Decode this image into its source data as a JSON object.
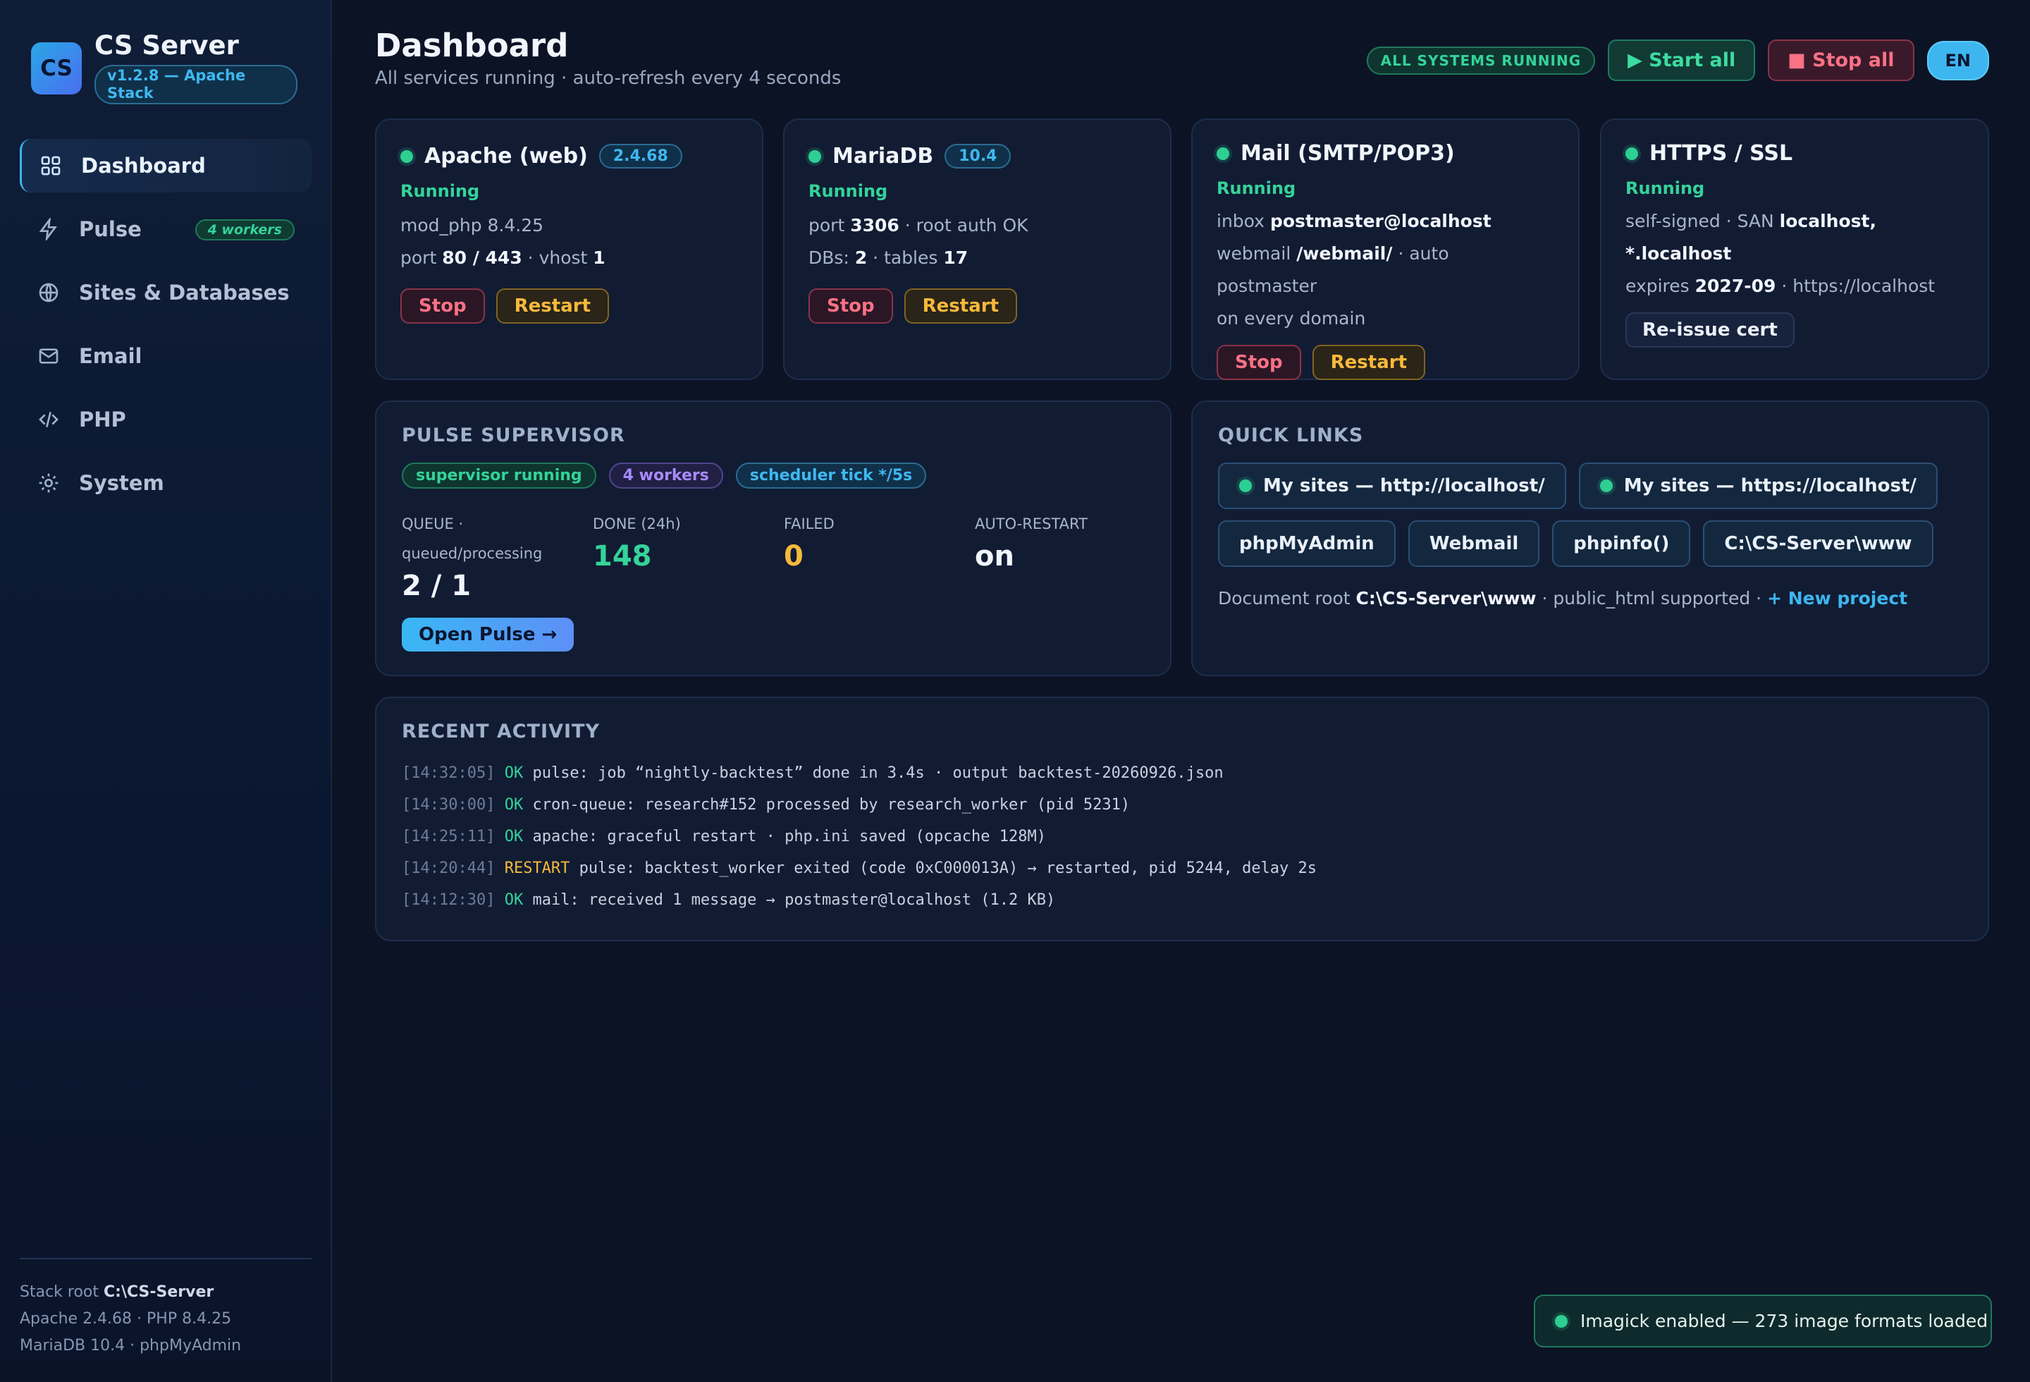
{
  "brand": {
    "logo": "CS",
    "title": "CS Server",
    "version": "v1.2.8 — Apache Stack"
  },
  "nav": [
    {
      "label": "Dashboard",
      "icon": "grid-icon",
      "active": true
    },
    {
      "label": "Pulse",
      "icon": "bolt-icon",
      "badge": "4 workers"
    },
    {
      "label": "Sites & Databases",
      "icon": "globe-icon"
    },
    {
      "label": "Email",
      "icon": "mail-icon"
    },
    {
      "label": "PHP",
      "icon": "code-icon"
    },
    {
      "label": "System",
      "icon": "gear-icon"
    }
  ],
  "sidebar_footer": {
    "stack_root_label": "Stack root",
    "stack_root": "C:\\CS-Server",
    "line2": "Apache 2.4.68 · PHP 8.4.25",
    "line3": "MariaDB 10.4 · phpMyAdmin"
  },
  "header": {
    "title": "Dashboard",
    "subtitle": "All services running · auto-refresh every 4 seconds",
    "status_pill": "ALL SYSTEMS RUNNING",
    "start_all": "▶ Start all",
    "stop_all": "■ Stop all",
    "lang": "EN"
  },
  "services": {
    "apache": {
      "name": "Apache (web)",
      "version": "2.4.68",
      "status": "Running",
      "line1": "mod_php 8.4.25",
      "port_label": "port",
      "port": "80 / 443",
      "vhost_label": "· vhost",
      "vhost": "1",
      "stop": "Stop",
      "restart": "Restart"
    },
    "mariadb": {
      "name": "MariaDB",
      "version": "10.4",
      "status": "Running",
      "port_label": "port",
      "port": "3306",
      "port_suffix": "· root auth OK",
      "dbs_label": "DBs:",
      "dbs": "2",
      "tables_label": "· tables",
      "tables": "17",
      "stop": "Stop",
      "restart": "Restart"
    },
    "mail": {
      "name": "Mail (SMTP/POP3)",
      "status": "Running",
      "inbox_label": "inbox",
      "inbox": "postmaster@localhost",
      "webmail_label": "webmail",
      "webmail": "/webmail/",
      "webmail_suffix": "· auto postmaster",
      "line3": "on every domain",
      "stop": "Stop",
      "restart": "Restart"
    },
    "ssl": {
      "name": "HTTPS / SSL",
      "status": "Running",
      "san_label": "self-signed · SAN",
      "san": "localhost,",
      "san2": "*.localhost",
      "expires_label": "expires",
      "expires": "2027-09",
      "expires_suffix": "· https://localhost",
      "reissue": "Re-issue cert"
    }
  },
  "pulse": {
    "title": "PULSE SUPERVISOR",
    "chips": [
      "supervisor running",
      "4 workers",
      "scheduler tick */5s"
    ],
    "stats": [
      {
        "label": "QUEUE ·",
        "label2": "queued/processing",
        "value": "2 / 1",
        "color": "#f1f5fc"
      },
      {
        "label": "DONE (24h)",
        "value": "148",
        "color": "#34d399"
      },
      {
        "label": "FAILED",
        "value": "0",
        "color": "#f6b93b"
      },
      {
        "label": "AUTO-RESTART",
        "value": "on",
        "color": "#f1f5fc"
      }
    ],
    "open_button": "Open Pulse →"
  },
  "quick_links": {
    "title": "QUICK LINKS",
    "site_http": "My sites — http://localhost/",
    "site_https": "My sites — https://localhost/",
    "links": [
      "phpMyAdmin",
      "Webmail",
      "phpinfo()",
      "C:\\CS-Server\\www"
    ],
    "doc_label": "Document root",
    "doc_root": "C:\\CS-Server\\www",
    "doc_suffix": "· public_html supported ·",
    "new_project": "+ New project"
  },
  "activity": {
    "title": "RECENT ACTIVITY",
    "entries": [
      {
        "time": "[14:32:05]",
        "level": "OK",
        "msg": "pulse: job “nightly-backtest” done in 3.4s · output backtest-20260926.json"
      },
      {
        "time": "[14:30:00]",
        "level": "OK",
        "msg": "cron-queue: research#152 processed by research_worker (pid 5231)"
      },
      {
        "time": "[14:25:11]",
        "level": "OK",
        "msg": "apache: graceful restart · php.ini saved (opcache 128M)"
      },
      {
        "time": "[14:20:44]",
        "level": "RESTART",
        "msg": "pulse: backtest_worker exited (code 0xC000013A) → restarted, pid 5244, delay 2s"
      },
      {
        "time": "[14:12:30]",
        "level": "OK",
        "msg": "mail: received 1 message → postmaster@localhost (1.2 KB)"
      }
    ]
  },
  "toast": {
    "text": "Imagick enabled — 273 image formats loaded"
  },
  "colors": {
    "accent": "#3db6f0",
    "success": "#34d399",
    "warning": "#f6b93b",
    "danger": "#f87185",
    "background": "#0c1325"
  }
}
